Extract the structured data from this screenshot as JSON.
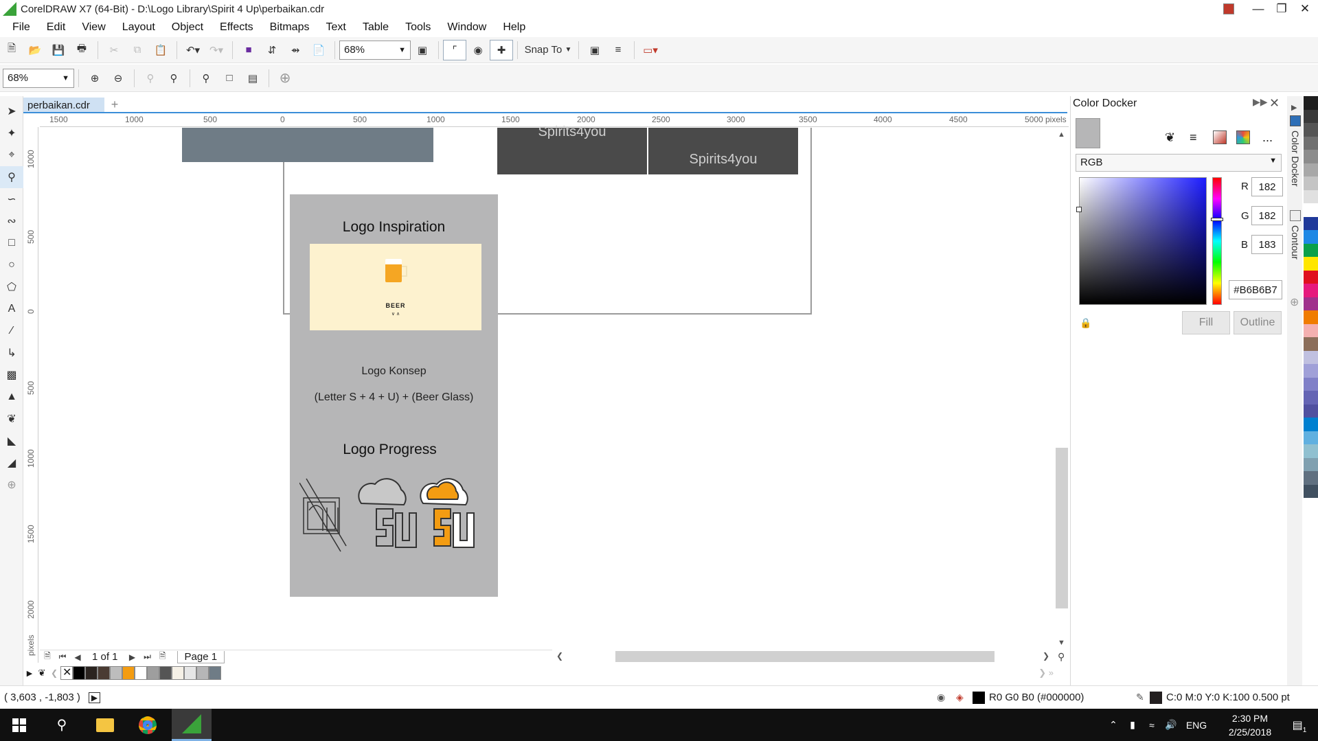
{
  "window": {
    "title": "CorelDRAW X7 (64-Bit) - D:\\Logo Library\\Spirit 4 Up\\perbaikan.cdr"
  },
  "menu": [
    "File",
    "Edit",
    "View",
    "Layout",
    "Object",
    "Effects",
    "Bitmaps",
    "Text",
    "Table",
    "Tools",
    "Window",
    "Help"
  ],
  "toolbar": {
    "zoom_value": "68%",
    "snap_to_label": "Snap To"
  },
  "property_bar": {
    "zoom_value": "68%"
  },
  "document": {
    "tab_name": "perbaikan.cdr",
    "ruler_h_labels": [
      "1500",
      "1000",
      "500",
      "0",
      "500",
      "1000",
      "1500",
      "2000",
      "2500",
      "3000",
      "3500",
      "4000",
      "4500",
      "5000",
      "pixels"
    ],
    "ruler_v_labels": [
      "1000",
      "500",
      "0",
      "500",
      "1000",
      "1500",
      "2000",
      "pixels"
    ]
  },
  "canvas": {
    "brand_text_1": "Spirits4you",
    "brand_text_2": "Spirits4you",
    "panel": {
      "heading_inspiration": "Logo Inspiration",
      "beer_label": "BEER",
      "beer_sub": "∨ ∧",
      "concept_title": "Logo Konsep",
      "concept_formula": "(Letter S + 4 + U) + (Beer Glass)",
      "heading_progress": "Logo Progress"
    },
    "colors": {
      "panel_bg": "#B6B6B7",
      "beer_bg": "#FDF2CF",
      "accent_orange": "#F39C12",
      "brand_box": "#4A4A4A"
    }
  },
  "page_nav": {
    "count": "1 of 1",
    "page_tab": "Page 1"
  },
  "doc_palette": [
    "#000000",
    "#2b2420",
    "#4a3b33",
    "#bdbdbd",
    "#f39c12",
    "#ffffff",
    "#9e9e9e",
    "#555555",
    "#f5f0e6",
    "#e6e6e6",
    "#b6b6b7",
    "#6f7c86"
  ],
  "status": {
    "cursor": "( 3,603 , -1,803 )",
    "fill_info": "R0 G0 B0 (#000000)",
    "outline_info": "C:0 M:0 Y:0 K:100  0.500 pt"
  },
  "docker": {
    "title": "Color Docker",
    "model": "RGB",
    "r_label": "R",
    "r_value": "182",
    "g_label": "G",
    "g_value": "182",
    "b_label": "B",
    "b_value": "183",
    "hex": "#B6B6B7",
    "fill_button": "Fill",
    "outline_button": "Outline",
    "side_tab_1": "Color Docker",
    "side_tab_2": "Contour",
    "more": "..."
  },
  "palette_column": [
    "#1e1e1e",
    "#3a3a3a",
    "#555555",
    "#707070",
    "#8c8c8c",
    "#a8a8a8",
    "#c4c4c4",
    "#e0e0e0",
    "#ffffff",
    "#203a9a",
    "#1e88e5",
    "#0aa04a",
    "#ffe600",
    "#e0101e",
    "#e6197d",
    "#a0308c",
    "#f07c00",
    "#f4b0b0",
    "#8c6e5a",
    "#c0c0e0",
    "#a0a0d8",
    "#8080c8",
    "#6464b4",
    "#5050a0",
    "#0080d0",
    "#60b0e0",
    "#90c0d0",
    "#80a0b0",
    "#607080",
    "#405060"
  ],
  "taskbar": {
    "lang": "ENG",
    "time": "2:30 PM",
    "date": "2/25/2018",
    "notif_count": "1"
  }
}
